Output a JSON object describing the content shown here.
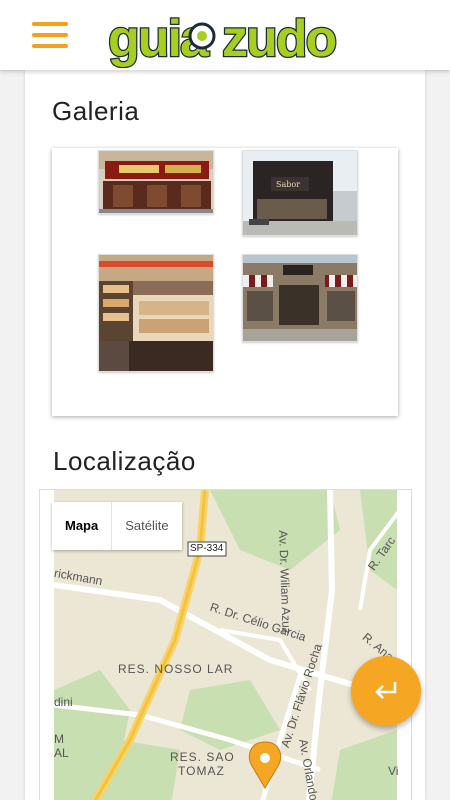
{
  "header": {
    "brand": "guiazudo",
    "menu_icon": "hamburger-menu-icon",
    "brand_color": "#a6cf1f",
    "accent_color": "#f5a01a"
  },
  "gallery": {
    "title": "Galeria",
    "images": [
      {
        "name": "gallery-photo-storefront-red"
      },
      {
        "name": "gallery-photo-storefront-dark"
      },
      {
        "name": "gallery-photo-bakery-interior"
      },
      {
        "name": "gallery-photo-storefront-awning"
      }
    ]
  },
  "location": {
    "title": "Localização",
    "map": {
      "toggle_map": "Mapa",
      "toggle_satellite": "Satélite",
      "labels": {
        "highway": "SP-334",
        "street_1": "R. Dr. Célio Garcia",
        "street_2": "Av. Dr. Wiliam Azuz",
        "street_3": "Av. Dr. Flávio Rocha",
        "street_4": "Av. Orlando",
        "neighborhood_1": "RES. NOSSO LAR",
        "neighborhood_2": "RES. SAO",
        "neighborhood_2b": "TOMAZ",
        "street_5": "rickmann",
        "street_6": "R. Tarc",
        "street_7": "R. Ana",
        "street_8": "dini",
        "street_9": "M",
        "street_10": "AL",
        "street_11": "Vi"
      }
    }
  },
  "fab": {
    "icon": "return-arrow-icon"
  }
}
